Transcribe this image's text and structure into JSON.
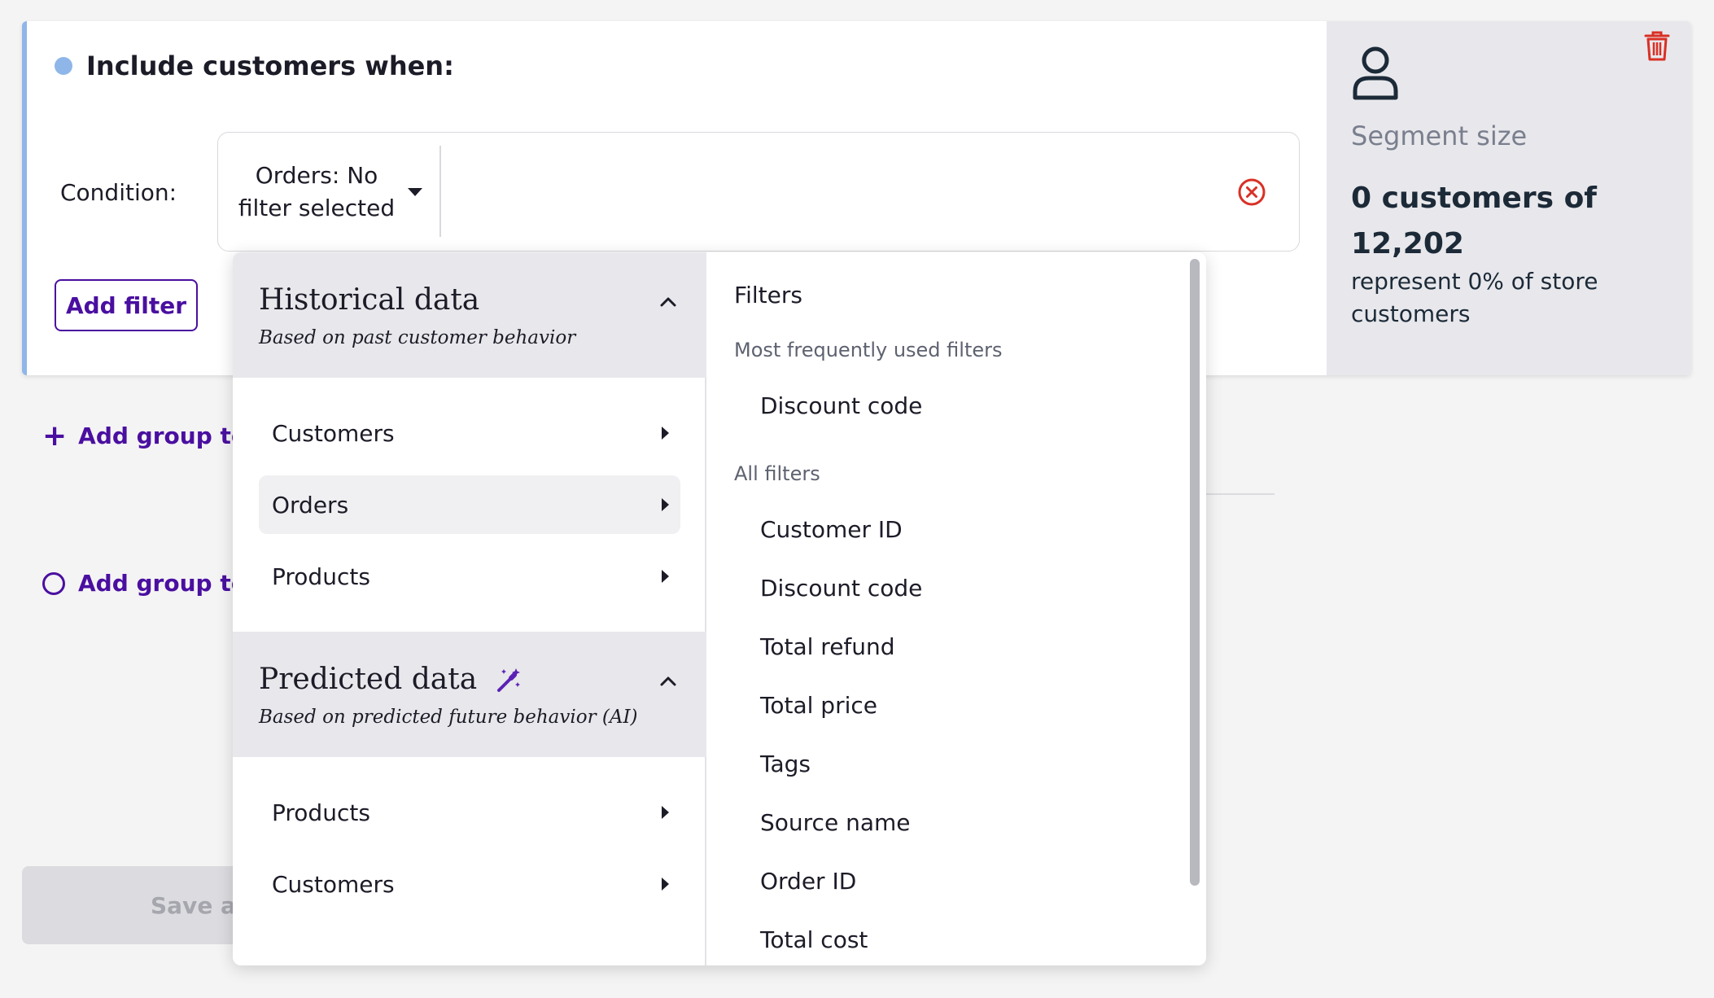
{
  "card": {
    "title": "Include customers when:",
    "condition_label": "Condition:",
    "condition_value": "Orders: No filter selected",
    "add_filter_label": "Add filter",
    "accent_color": "#8fb6e8"
  },
  "segment": {
    "label": "Segment size",
    "count": "0 customers of 12,202",
    "description": "represent 0% of store customers"
  },
  "actions": {
    "add_group_include": "Add group to i",
    "add_group_exclude": "Add group to e",
    "save": "Save au"
  },
  "dropdown": {
    "historical": {
      "title": "Historical data",
      "subtitle": "Based on past customer behavior",
      "items": [
        "Customers",
        "Orders",
        "Products"
      ],
      "active_item": "Orders"
    },
    "predicted": {
      "title": "Predicted data",
      "subtitle": "Based on predicted future behavior (AI)",
      "items": [
        "Products",
        "Customers"
      ]
    },
    "filters": {
      "title": "Filters",
      "frequent_heading": "Most frequently used filters",
      "frequent": [
        "Discount code"
      ],
      "all_heading": "All filters",
      "all": [
        "Customer ID",
        "Discount code",
        "Total refund",
        "Total price",
        "Tags",
        "Source name",
        "Order ID",
        "Total cost"
      ]
    }
  },
  "colors": {
    "brand": "#4a0fa0",
    "danger": "#d93025",
    "panel": "#e8e8ec"
  },
  "icons": [
    "clear-icon",
    "person-icon",
    "trash-icon",
    "chevron-up-icon",
    "magic-wand-icon",
    "plus-icon",
    "circle-icon"
  ]
}
